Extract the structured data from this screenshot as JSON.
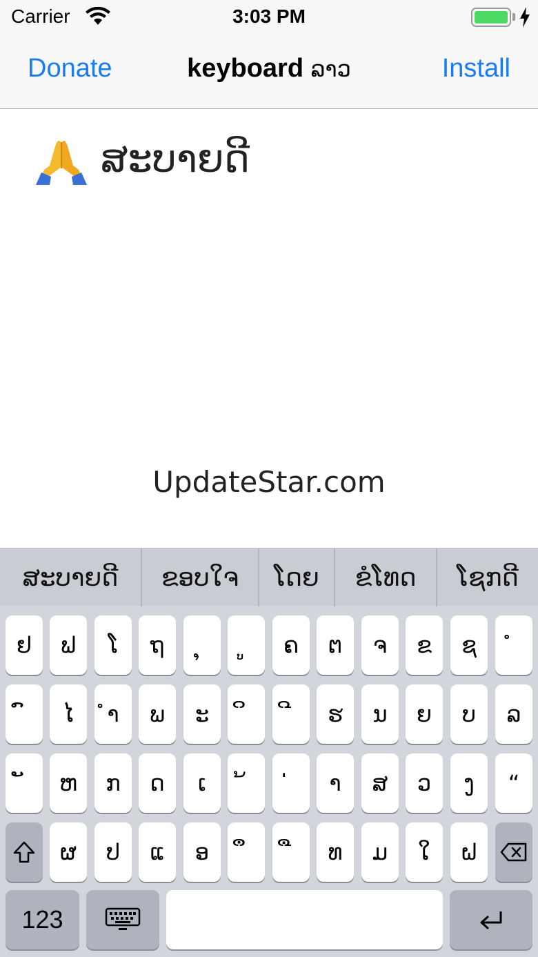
{
  "status_bar": {
    "carrier": "Carrier",
    "time": "3:03 PM",
    "battery_color": "#4cd964"
  },
  "nav": {
    "left_button": "Donate",
    "title_bold": "keyboard",
    "title_lao": "ລາວ",
    "right_button": "Install",
    "accent_color": "#1a7cf4"
  },
  "content": {
    "emoji_icon": "praying-hands-icon",
    "typed_text": "ສະບາຍດີ",
    "watermark": "UpdateStar.com"
  },
  "keyboard": {
    "suggestions": [
      "ສະບາຍດີ",
      "ຂອບໃຈ",
      "ໂດຍ",
      "ຂໍໂທດ",
      "ໂຊກດີ"
    ],
    "row1": [
      "ຢ",
      "ຟ",
      "ໂ",
      "ຖ",
      "ຸ",
      "ູ",
      "ຄ",
      "ຕ",
      "ຈ",
      "ຂ",
      "ຊ",
      "ໍ"
    ],
    "row2": [
      "ົ",
      "ໄ",
      "ຳ",
      "ພ",
      "ະ",
      "ິ",
      "ີ",
      "ຮ",
      "ນ",
      "ຍ",
      "ບ",
      "ລ"
    ],
    "row3": [
      "ັ",
      "ຫ",
      "ກ",
      "ດ",
      "ເ",
      "້",
      "່",
      "າ",
      "ສ",
      "ວ",
      "ງ",
      "“"
    ],
    "row4": [
      "ຜ",
      "ປ",
      "ແ",
      "ອ",
      "ຶ",
      "ື",
      "ທ",
      "ມ",
      "ໃ",
      "ຝ"
    ],
    "numbers_label": "123"
  }
}
